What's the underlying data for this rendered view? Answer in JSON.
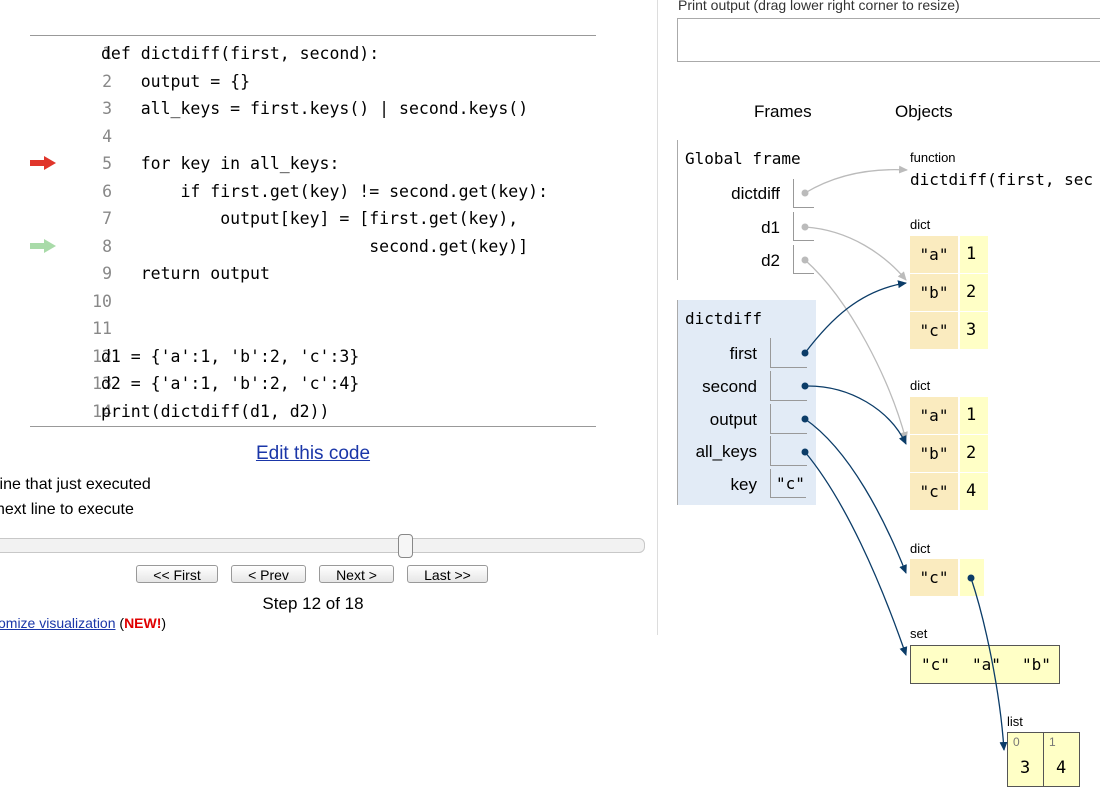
{
  "code": {
    "lines": [
      {
        "num": "1",
        "text": "def dictdiff(first, second):"
      },
      {
        "num": "2",
        "text": "    output = {}"
      },
      {
        "num": "3",
        "text": "    all_keys = first.keys() | second.keys()"
      },
      {
        "num": "4",
        "text": ""
      },
      {
        "num": "5",
        "text": "    for key in all_keys:"
      },
      {
        "num": "6",
        "text": "        if first.get(key) != second.get(key):"
      },
      {
        "num": "7",
        "text": "            output[key] = [first.get(key),"
      },
      {
        "num": "8",
        "text": "                           second.get(key)]"
      },
      {
        "num": "9",
        "text": "    return output"
      },
      {
        "num": "10",
        "text": ""
      },
      {
        "num": "11",
        "text": ""
      },
      {
        "num": "12",
        "text": "d1 = {'a':1, 'b':2, 'c':3}"
      },
      {
        "num": "13",
        "text": "d2 = {'a':1, 'b':2, 'c':4}"
      },
      {
        "num": "14",
        "text": "print(dictdiff(d1, d2))"
      }
    ],
    "just_executed_line": "5",
    "next_line": "8",
    "colors": {
      "just_executed": "#e0352b",
      "next_line": "#a9dba9"
    }
  },
  "edit_link": "Edit this code",
  "legend": {
    "just_executed": "line that just executed",
    "next": "next line to execute"
  },
  "nav": {
    "first": "<< First",
    "prev": "< Prev",
    "next": "Next >",
    "last": "Last >>",
    "step_label": "Step 12 of 18",
    "step": 12,
    "total_steps": 18
  },
  "customize": {
    "link": "omize visualization",
    "paren_open": "(",
    "new_badge": "NEW!",
    "paren_close": ")"
  },
  "print_output": {
    "label": "Print output (drag lower right corner to resize)",
    "value": ""
  },
  "headers": {
    "frames": "Frames",
    "objects": "Objects"
  },
  "global_frame": {
    "title": "Global frame",
    "vars": [
      {
        "name": "dictdiff"
      },
      {
        "name": "d1"
      },
      {
        "name": "d2"
      }
    ]
  },
  "func_frame": {
    "title": "dictdiff",
    "vars": [
      {
        "name": "first",
        "value": ""
      },
      {
        "name": "second",
        "value": ""
      },
      {
        "name": "output",
        "value": ""
      },
      {
        "name": "all_keys",
        "value": ""
      },
      {
        "name": "key",
        "value": "\"c\""
      }
    ]
  },
  "objects": {
    "function": {
      "type": "function",
      "label": "dictdiff(first, sec"
    },
    "dict1": {
      "type": "dict",
      "entries": [
        {
          "k": "\"a\"",
          "v": "1"
        },
        {
          "k": "\"b\"",
          "v": "2"
        },
        {
          "k": "\"c\"",
          "v": "3"
        }
      ]
    },
    "dict2": {
      "type": "dict",
      "entries": [
        {
          "k": "\"a\"",
          "v": "1"
        },
        {
          "k": "\"b\"",
          "v": "2"
        },
        {
          "k": "\"c\"",
          "v": "4"
        }
      ]
    },
    "dict3": {
      "type": "dict",
      "entries": [
        {
          "k": "\"c\""
        }
      ]
    },
    "set": {
      "type": "set",
      "items": [
        "\"c\"",
        "\"a\"",
        "\"b\""
      ]
    },
    "list": {
      "type": "list",
      "indices": [
        "0",
        "1"
      ],
      "items": [
        "3",
        "4"
      ]
    }
  }
}
